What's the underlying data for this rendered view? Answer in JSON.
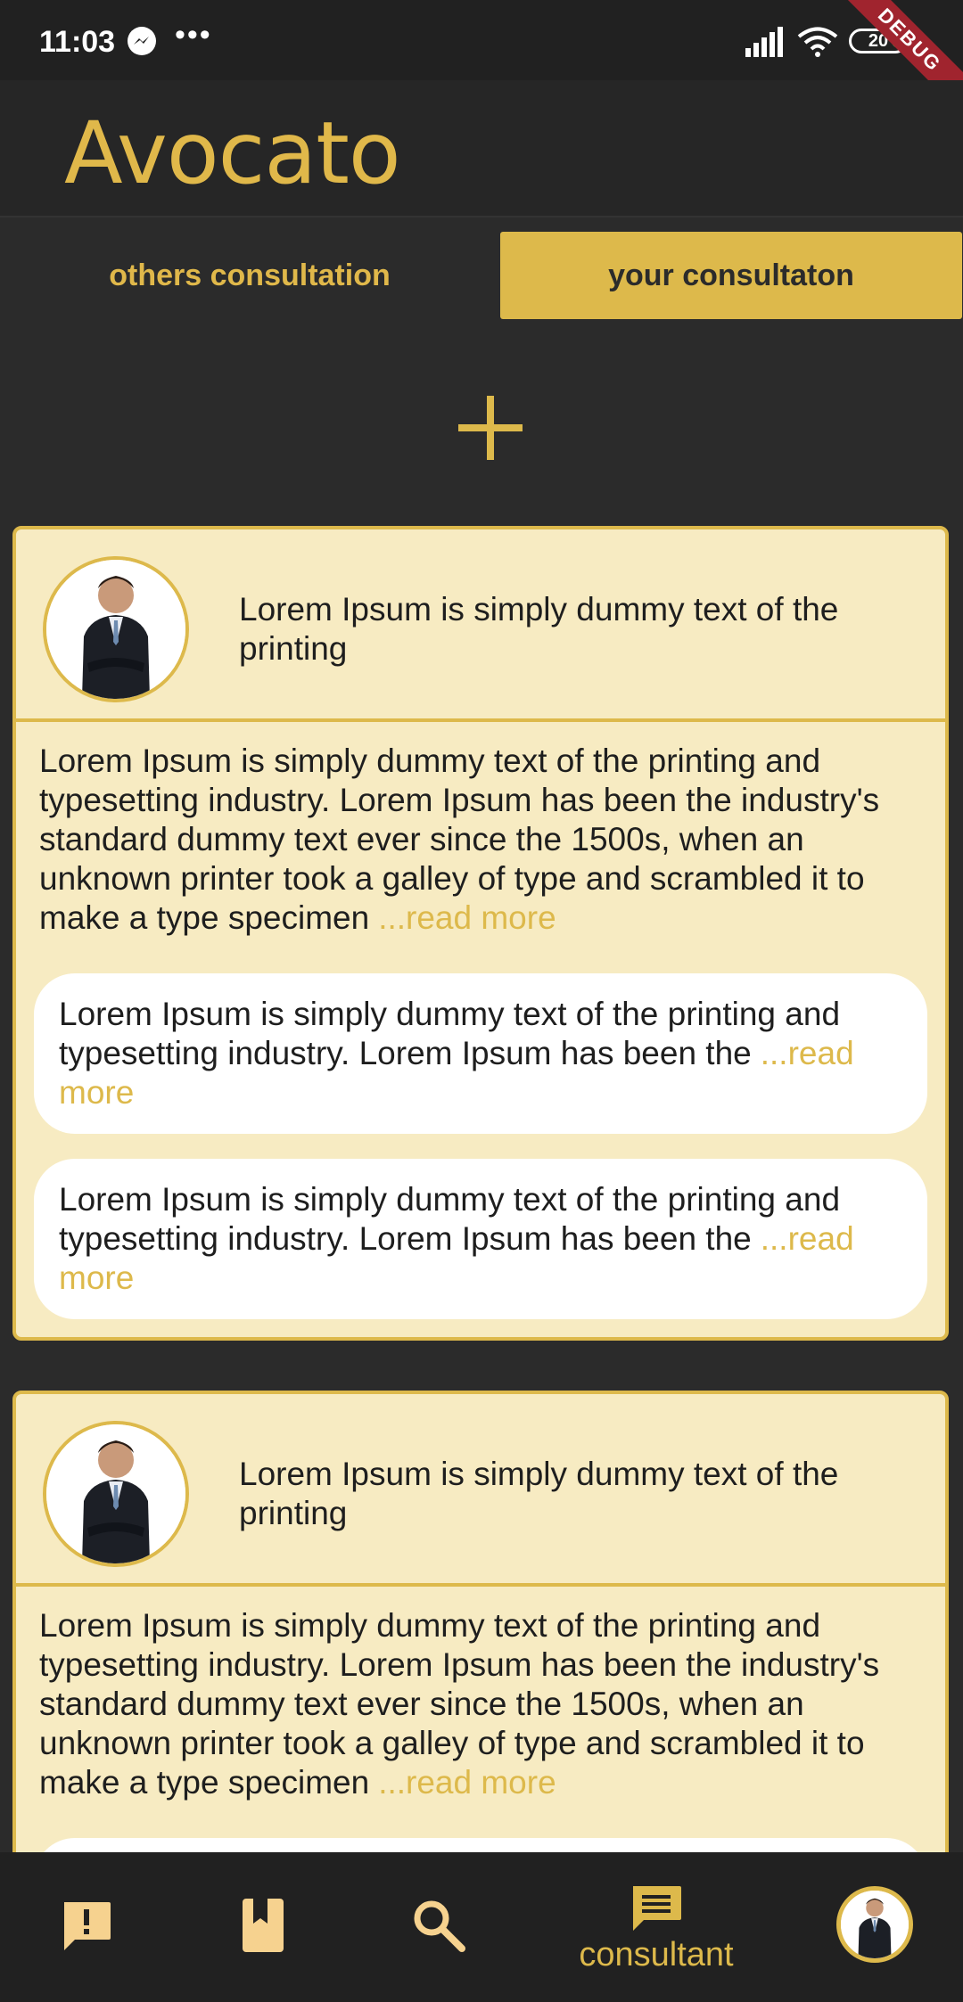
{
  "status_bar": {
    "time": "11:03",
    "dots": "•••",
    "battery": "20",
    "debug": "DEBUG"
  },
  "app": {
    "title": "Avocato"
  },
  "tabs": {
    "others": "others consultation",
    "yours": "your consultaton"
  },
  "cards": [
    {
      "title": "Lorem Ipsum is simply dummy text of the printing",
      "body": "Lorem Ipsum is simply dummy text of the printing and typesetting industry. Lorem Ipsum has been the industry's standard dummy text ever since the 1500s, when an unknown printer took a galley of type and scrambled it to make a type specimen",
      "read_more": "...read more",
      "replies": [
        {
          "text": "Lorem Ipsum is simply dummy text of the printing and typesetting industry. Lorem Ipsum has been the",
          "read_more": "...read more"
        },
        {
          "text": "Lorem Ipsum is simply dummy text of the printing and typesetting industry. Lorem Ipsum has been the",
          "read_more": "...read more"
        }
      ]
    },
    {
      "title": "Lorem Ipsum is simply dummy text of the printing",
      "body": "Lorem Ipsum is simply dummy text of the printing and typesetting industry. Lorem Ipsum has been the industry's standard dummy text ever since the 1500s, when an unknown printer took a galley of type and scrambled it to make a type specimen",
      "read_more": "...read more",
      "replies": [
        {
          "text": "",
          "read_more": ""
        }
      ]
    }
  ],
  "bottom_nav": {
    "active_label": "consultant",
    "items": [
      "alert-icon",
      "bookmark-icon",
      "search-icon",
      "chat-icon",
      "profile-avatar"
    ]
  },
  "colors": {
    "accent": "#ddb94b",
    "card_bg": "#f7ebc2",
    "background": "#2b2b2b"
  }
}
